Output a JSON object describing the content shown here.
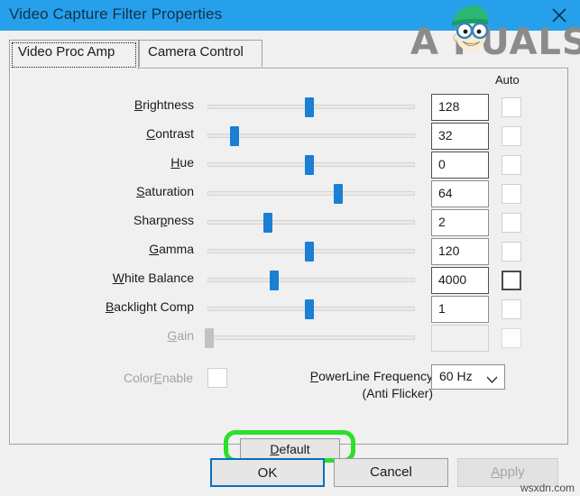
{
  "window": {
    "title": "Video Capture Filter Properties",
    "close_icon": "close-icon",
    "titlebar_color": "#27a0ec"
  },
  "logo": {
    "text": "A  PUALS",
    "alt": "appuals-logo"
  },
  "tabs": [
    {
      "label": "Video Proc Amp",
      "selected": true
    },
    {
      "label": "Camera Control",
      "selected": false
    }
  ],
  "panel": {
    "auto_column_header": "Auto"
  },
  "sliders": [
    {
      "label_pre": "B",
      "label_accel": "",
      "label": "Brightness",
      "accel": "B",
      "value": "128",
      "thumb_pct": 49,
      "auto_checked": false,
      "auto_strong": false,
      "disabled": false,
      "value_strong": true
    },
    {
      "label": "Contrast",
      "accel": "C",
      "value": "32",
      "thumb_pct": 13,
      "auto_checked": false,
      "auto_strong": false,
      "disabled": false,
      "value_strong": true
    },
    {
      "label": "Hue",
      "accel": "H",
      "value": "0",
      "thumb_pct": 49,
      "auto_checked": false,
      "auto_strong": false,
      "disabled": false,
      "value_strong": true
    },
    {
      "label": "Saturation",
      "accel": "S",
      "value": "64",
      "thumb_pct": 63,
      "auto_checked": false,
      "auto_strong": false,
      "disabled": false,
      "value_strong": false
    },
    {
      "label": "Sharpness",
      "accel": "p",
      "value": "2",
      "thumb_pct": 29,
      "auto_checked": false,
      "auto_strong": false,
      "disabled": false,
      "value_strong": false
    },
    {
      "label": "Gamma",
      "accel": "G",
      "value": "120",
      "thumb_pct": 49,
      "auto_checked": false,
      "auto_strong": false,
      "disabled": false,
      "value_strong": false
    },
    {
      "label": "White Balance",
      "accel": "W",
      "value": "4000",
      "thumb_pct": 32,
      "auto_checked": false,
      "auto_strong": true,
      "disabled": false,
      "value_strong": true
    },
    {
      "label": "Backlight Comp",
      "accel": "B",
      "value": "1",
      "thumb_pct": 49,
      "auto_checked": false,
      "auto_strong": false,
      "disabled": false,
      "value_strong": false
    },
    {
      "label": "Gain",
      "accel": "G",
      "value": "",
      "thumb_pct": 1,
      "auto_checked": false,
      "auto_strong": false,
      "disabled": true,
      "value_strong": false
    }
  ],
  "color_enable": {
    "label_before": "Color",
    "label_accel": "E",
    "label_after": "nable",
    "checked": false,
    "disabled": true
  },
  "powerline": {
    "label_accel": "P",
    "label_line1_rest": "owerLine Frequency",
    "label_line2": "(Anti Flicker)",
    "selected_value": "60 Hz",
    "chevron_icon": "chevron-down-icon"
  },
  "buttons": {
    "default_accel": "D",
    "default_rest": "efault",
    "ok": "OK",
    "cancel": "Cancel",
    "apply_accel": "A",
    "apply_rest": "pply",
    "apply_disabled": true,
    "annotation_color": "#2ae02a"
  },
  "watermark": "wsxdn.com"
}
